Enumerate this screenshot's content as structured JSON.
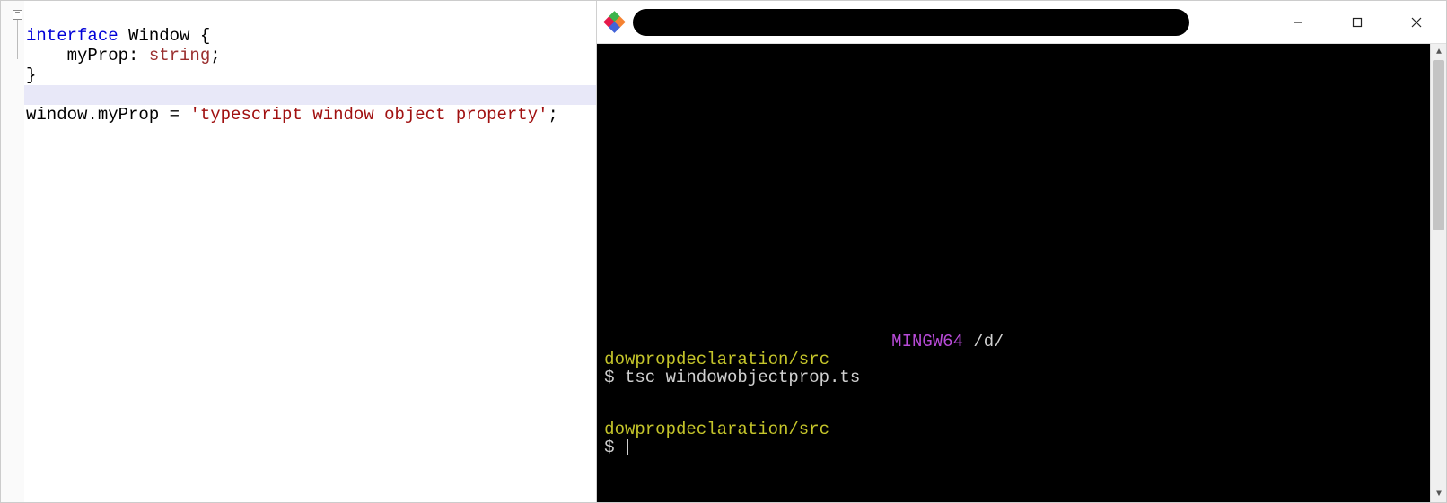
{
  "editor": {
    "fold_marker": "−",
    "code": {
      "l1_kw": "interface",
      "l1_rest": " Window {",
      "l2_prop": "    myProp: ",
      "l2_type": "string",
      "l2_end": ";",
      "l3": "}",
      "l5_pre": "window.myProp = ",
      "l5_str": "'typescript window object property'",
      "l5_end": ";"
    }
  },
  "terminal": {
    "titlebar": {
      "minimize_title": "Minimize",
      "maximize_title": "Maximize",
      "close_title": "Close"
    },
    "lines": {
      "env": "MINGW64",
      "path_suffix": " /d/",
      "cwd": "dowpropdeclaration/src",
      "prompt_sym": "$ ",
      "cmd": "tsc windowobjectprop.ts",
      "cwd2": "dowpropdeclaration/src",
      "prompt_sym2": "$ "
    },
    "scroll": {
      "up": "▲",
      "down": "▼"
    }
  }
}
